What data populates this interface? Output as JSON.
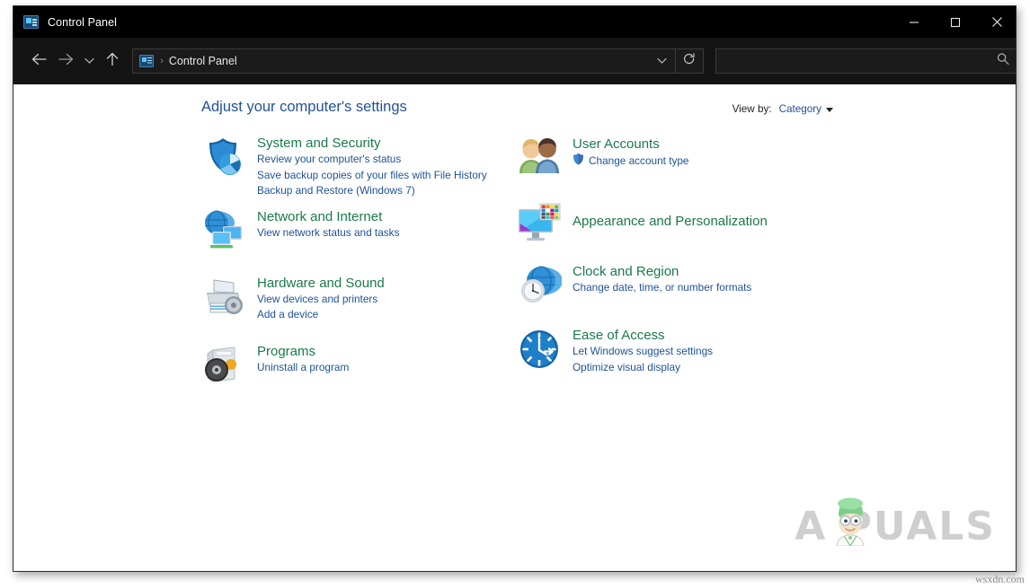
{
  "window": {
    "title": "Control Panel",
    "title_icon": "control-panel-icon",
    "controls": {
      "minimize": "minimize-icon",
      "maximize": "maximize-icon",
      "close": "close-icon"
    }
  },
  "navbar": {
    "back": "back-arrow-icon",
    "forward": "forward-arrow-icon",
    "recent": "chevron-down-icon",
    "up": "up-arrow-icon",
    "address": {
      "icon": "control-panel-icon",
      "separator": "›",
      "crumb": "Control Panel",
      "dropdown": "chevron-down-icon",
      "refresh": "refresh-icon"
    },
    "search": {
      "value": "",
      "placeholder": "",
      "icon": "search-icon"
    }
  },
  "main": {
    "headline": "Adjust your computer's settings",
    "view_by": {
      "label": "View by:",
      "value": "Category",
      "caret": "caret-down-icon"
    },
    "left_column": [
      {
        "id": "system-and-security",
        "icon": "shield-chart-icon",
        "title": "System and Security",
        "links": [
          {
            "text": "Review your computer's status",
            "shield": false
          },
          {
            "text": "Save backup copies of your files with File History",
            "shield": false
          },
          {
            "text": "Backup and Restore (Windows 7)",
            "shield": false
          }
        ]
      },
      {
        "id": "network-and-internet",
        "icon": "globe-monitors-icon",
        "title": "Network and Internet",
        "links": [
          {
            "text": "View network status and tasks",
            "shield": false
          }
        ]
      },
      {
        "id": "hardware-and-sound",
        "icon": "printer-speaker-icon",
        "title": "Hardware and Sound",
        "links": [
          {
            "text": "View devices and printers",
            "shield": false
          },
          {
            "text": "Add a device",
            "shield": false
          }
        ]
      },
      {
        "id": "programs",
        "icon": "programs-disc-icon",
        "title": "Programs",
        "links": [
          {
            "text": "Uninstall a program",
            "shield": false
          }
        ]
      }
    ],
    "right_column": [
      {
        "id": "user-accounts",
        "icon": "two-people-icon",
        "title": "User Accounts",
        "links": [
          {
            "text": "Change account type",
            "shield": true
          }
        ]
      },
      {
        "id": "appearance-and-personalization",
        "icon": "monitor-palette-icon",
        "title": "Appearance and Personalization",
        "links": []
      },
      {
        "id": "clock-and-region",
        "icon": "globe-clock-icon",
        "title": "Clock and Region",
        "links": [
          {
            "text": "Change date, time, or number formats",
            "shield": false
          }
        ]
      },
      {
        "id": "ease-of-access",
        "icon": "ease-of-access-icon",
        "title": "Ease of Access",
        "links": [
          {
            "text": "Let Windows suggest settings",
            "shield": false
          },
          {
            "text": "Optimize visual display",
            "shield": false
          }
        ]
      }
    ]
  },
  "watermark": {
    "brand": "A PUALS",
    "brand_prefix": "A",
    "brand_suffix": "PUALS",
    "mascot": "mascot-icon"
  },
  "site_mark": "wsxdn.com",
  "colors": {
    "titlebar": "#000000",
    "navbar": "#141414",
    "category_title": "#1a7a4a",
    "link": "#1f5298",
    "headline": "#1f5298",
    "content_bg": "#ffffff",
    "watermark": "#cfcfcf"
  }
}
